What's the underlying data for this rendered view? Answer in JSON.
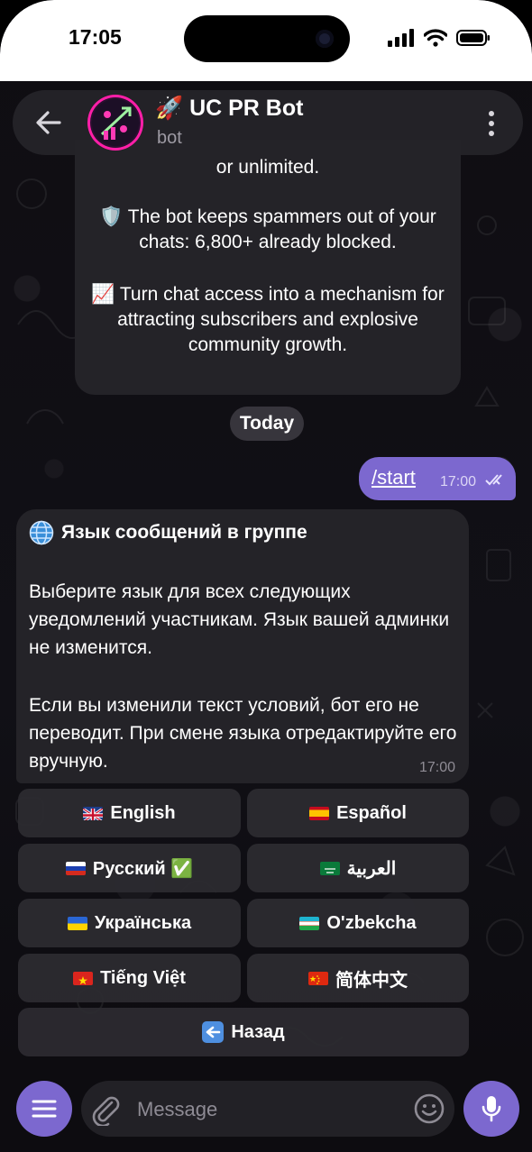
{
  "status": {
    "time": "17:05"
  },
  "header": {
    "title": "🚀 UC PR Bot",
    "subtitle": "bot"
  },
  "messages": {
    "intro": {
      "line0": "or unlimited.",
      "p1": "🛡️ The bot keeps spammers out of your chats: 6,800+ already blocked.",
      "p2": "📈 Turn chat access into a mechanism for attracting subscribers and explosive community growth."
    },
    "date_separator": "Today",
    "outgoing": {
      "text": "/start",
      "time": "17:00"
    },
    "language": {
      "title": "Язык сообщений в группе",
      "body1": "Выберите язык для всех следующих уведомлений участникам. Язык вашей админки не изменится.",
      "body2": "Если вы изменили текст условий, бот его не переводит. При смене языка отредактируйте его вручную.",
      "time": "17:00"
    }
  },
  "keyboard": {
    "english": "English",
    "espanol": "Español",
    "russian": "Русский ✅",
    "arabic": "العربية",
    "ukrainian": "Українська",
    "uzbek": "O'zbekcha",
    "vietnamese": "Tiếng Việt",
    "chinese": "简体中文",
    "back": "Назад"
  },
  "composer": {
    "placeholder": "Message"
  },
  "colors": {
    "accent": "#7c68cf",
    "bubble": "#242328",
    "background": "#0d0b0f"
  },
  "icons": [
    "back-arrow-icon",
    "more-icon",
    "globe-icon",
    "double-check-icon",
    "menu-icon",
    "paperclip-icon",
    "emoji-icon",
    "microphone-icon",
    "back-arrow-emoji-icon"
  ]
}
